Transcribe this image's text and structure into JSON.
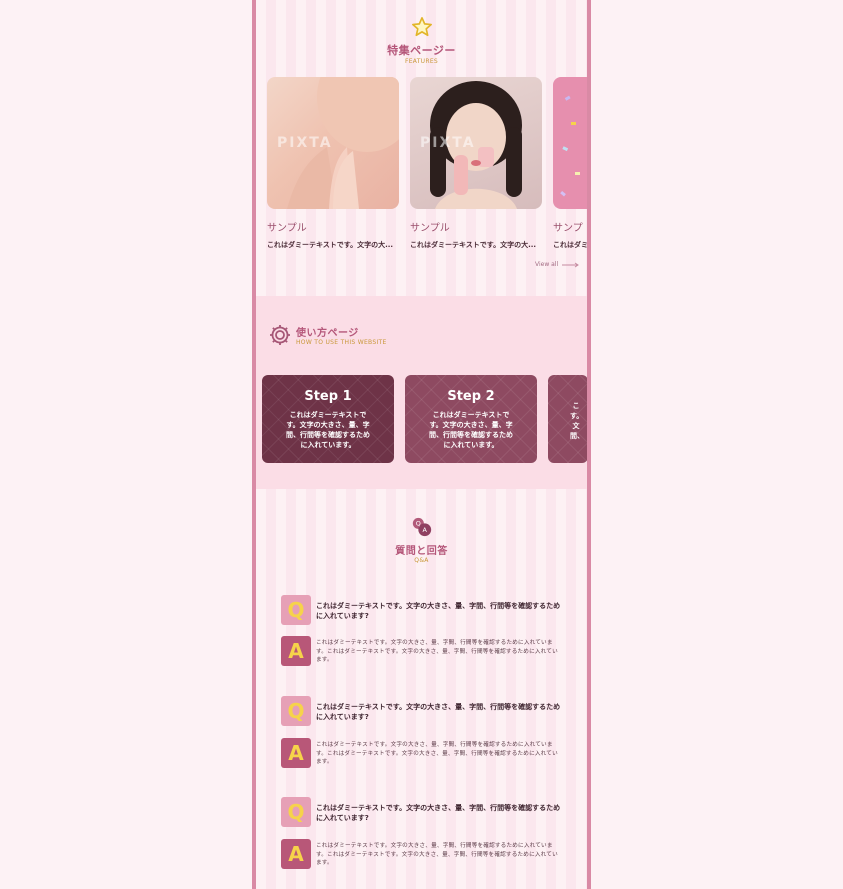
{
  "colors": {
    "accent": "#b5577a",
    "gold": "#c9983a",
    "step1": "#6e3347",
    "step2": "#8e4a61"
  },
  "features": {
    "title": "特集ページー",
    "subtitle": "FEATURES",
    "icon": "star-icon",
    "cards": [
      {
        "title": "サンプル",
        "desc": "これはダミーテキストです。文字の大...",
        "watermark": "PIXTA"
      },
      {
        "title": "サンプル",
        "desc": "これはダミーテキストです。文字の大...",
        "watermark": "PIXTA"
      },
      {
        "title": "サンプ",
        "desc": "これはダミ",
        "watermark": ""
      }
    ],
    "view_all": "View all"
  },
  "howto": {
    "title": "使い方ページ",
    "subtitle": "HOW TO USE THIS WEBSITE",
    "icon": "gear-icon",
    "steps": [
      {
        "title": "Step 1",
        "desc": "これはダミーテキストです。文字の大きさ、量、字間、行間等を確認するために入れています。"
      },
      {
        "title": "Step 2",
        "desc": "これはダミーテキストです。文字の大きさ、量、字間、行間等を確認するために入れています。"
      },
      {
        "title": "",
        "desc": "こ す。文 間、"
      }
    ]
  },
  "qa": {
    "title": "質問と回答",
    "subtitle": "Q&A",
    "icon": "speech-bubbles-icon",
    "q_label": "Q",
    "a_label": "A",
    "items": [
      {
        "q": "これはダミーテキストです。文字の大きさ、量、字間、行間等を確認するために入れています?",
        "a": "これはダミーテキストです。文字の大きさ、量、字間、行間等を確認するために入れています。これはダミーテキストです。文字の大きさ、量、字間、行間等を確認するために入れています。"
      },
      {
        "q": "これはダミーテキストです。文字の大きさ、量、字間、行間等を確認するために入れています?",
        "a": "これはダミーテキストです。文字の大きさ、量、字間、行間等を確認するために入れています。これはダミーテキストです。文字の大きさ、量、字間、行間等を確認するために入れています。"
      },
      {
        "q": "これはダミーテキストです。文字の大きさ、量、字間、行間等を確認するために入れています?",
        "a": "これはダミーテキストです。文字の大きさ、量、字間、行間等を確認するために入れています。これはダミーテキストです。文字の大きさ、量、字間、行間等を確認するために入れています。"
      }
    ]
  }
}
